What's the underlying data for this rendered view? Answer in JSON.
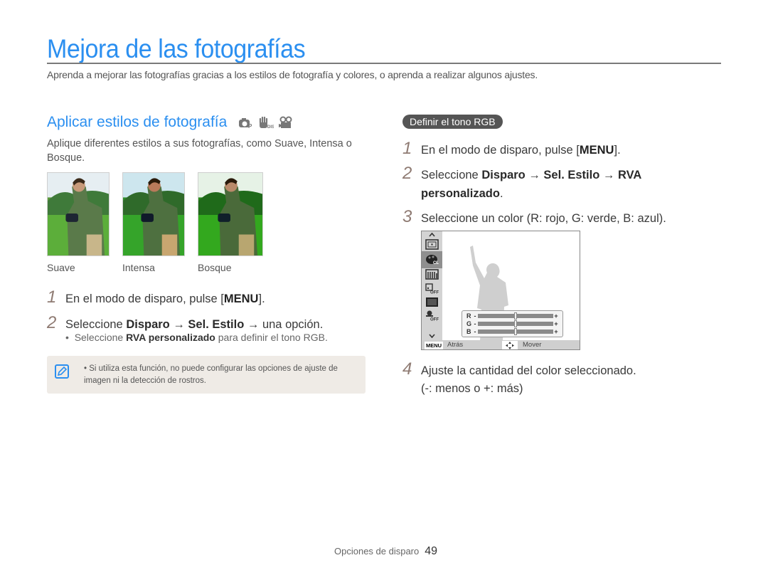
{
  "header": {
    "title": "Mejora de las fotografías",
    "intro": "Aprenda a mejorar las fotografías gracias a los estilos de fotografía y colores, o aprenda a realizar algunos ajustes."
  },
  "left": {
    "section_title": "Aplicar estilos de fotografía",
    "mode_icons": [
      "camera-program-icon",
      "hand-dis-icon",
      "movie-camera-icon"
    ],
    "description": "Aplique diferentes estilos a sus fotografías, como Suave, Intensa o Bosque.",
    "samples": [
      {
        "label": "Suave"
      },
      {
        "label": "Intensa"
      },
      {
        "label": "Bosque"
      }
    ],
    "steps": [
      {
        "num": "1",
        "pre": "En el modo de disparo, pulse [",
        "key": "MENU",
        "post": "]."
      },
      {
        "num": "2",
        "pre": "Seleccione ",
        "b1": "Disparo",
        "arrow1": " → ",
        "b2": "Sel. Estilo",
        "arrow2": " → ",
        "post": "una opción."
      }
    ],
    "bullet": {
      "pre": "Seleccione ",
      "bold": "RVA personalizado",
      "post": " para definir el tono RGB."
    },
    "note": "Si utiliza esta función, no puede configurar las opciones de ajuste de imagen ni la detección de rostros."
  },
  "right": {
    "pill": "Definir el tono RGB",
    "steps": [
      {
        "num": "1",
        "pre": "En el modo de disparo, pulse [",
        "key": "MENU",
        "post": "]."
      },
      {
        "num": "2",
        "pre": "Seleccione ",
        "b1": "Disparo",
        "arrow1": " → ",
        "b2": "Sel. Estilo",
        "arrow2": " → ",
        "b3": "RVA",
        "b4": "personalizado",
        "post": "."
      },
      {
        "num": "3",
        "text": "Seleccione un color (R: rojo, G: verde, B: azul)."
      },
      {
        "num": "4",
        "line1": "Ajuste la cantidad del color seleccionado.",
        "line2": "(-: menos o +: más)"
      }
    ],
    "lcd": {
      "sliders": [
        {
          "letter": "R",
          "value": 0.5
        },
        {
          "letter": "G",
          "value": 0.5
        },
        {
          "letter": "B",
          "value": 0.5
        }
      ],
      "minus": "-",
      "plus": "+",
      "menu_key": "MENU",
      "back_label": "Atrás",
      "move_label": "Mover"
    }
  },
  "footer": {
    "section": "Opciones de disparo",
    "page": "49"
  }
}
